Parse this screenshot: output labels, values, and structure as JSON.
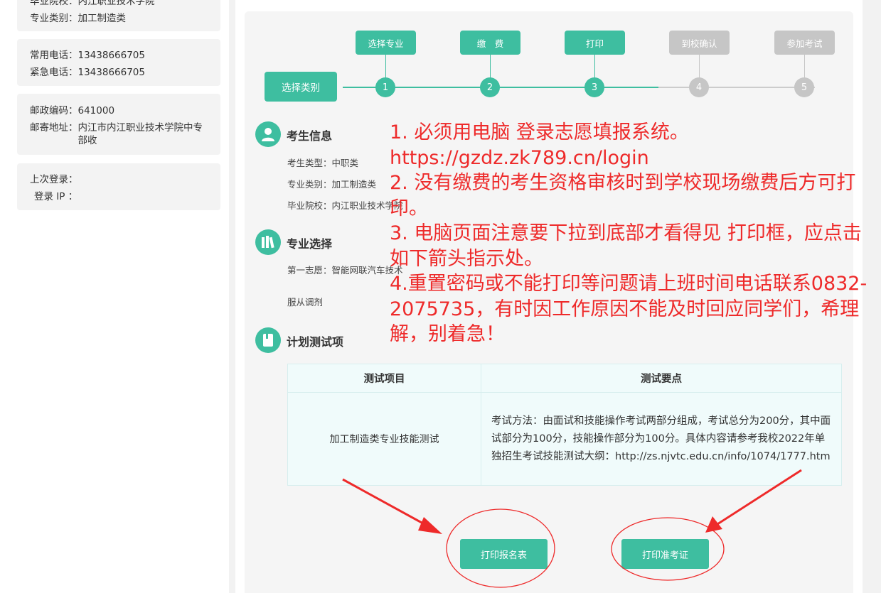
{
  "sidebar": {
    "card1": [
      {
        "label": "毕业院校：",
        "value": "内江职业技术学院"
      },
      {
        "label": "专业类别：",
        "value": "加工制造类"
      }
    ],
    "card2": [
      {
        "label": "常用电话：",
        "value": "13438666705"
      },
      {
        "label": "紧急电话：",
        "value": "13438666705"
      }
    ],
    "card3": [
      {
        "label": "邮政编码：",
        "value": "641000"
      },
      {
        "label": "邮寄地址：",
        "value": "内江市内江职业技术学院中专部收"
      }
    ],
    "card4": [
      {
        "label": "上次登录：",
        "value": ""
      },
      {
        "label": "登录 IP ：",
        "value": ""
      }
    ]
  },
  "steps": {
    "category_button": "选择类别",
    "items": [
      {
        "label": "选择专业",
        "number": "1",
        "active": true
      },
      {
        "label": "缴　费",
        "number": "2",
        "active": true
      },
      {
        "label": "打印",
        "number": "3",
        "active": true
      },
      {
        "label": "到校确认",
        "number": "4",
        "active": false
      },
      {
        "label": "参加考试",
        "number": "5",
        "active": false
      }
    ]
  },
  "student_info": {
    "title": "考生信息",
    "rows": [
      {
        "label": "考生类型：",
        "value": "中职类"
      },
      {
        "label": "专业类别：",
        "value": "加工制造类"
      },
      {
        "label": "毕业院校：",
        "value": "内江职业技术学院"
      }
    ]
  },
  "major_choice": {
    "title": "专业选择",
    "first_choice_label": "第一志愿：",
    "first_choice_value": "智能网联汽车技术",
    "obey_adjust": "服从调剂"
  },
  "test_plan": {
    "title": "计划测试项",
    "headers": [
      "测试项目",
      "测试要点"
    ],
    "item": "加工制造类专业技能测试",
    "details": "考试方法：由面试和技能操作考试两部分组成，考试总分为200分，其中面试部分为100分，技能操作部分为100分。具体内容请参考我校2022年单独招生考试技能测试大纲：http://zs.njvtc.edu.cn/info/1074/1777.htm"
  },
  "buttons": {
    "print_form": "打印报名表",
    "print_admission": "打印准考证"
  },
  "notice": [
    "1. 必须用电脑 登录志愿填报系统。",
    "https://gzdz.zk789.cn/login",
    "2. 没有缴费的考生资格审核时到学校现场缴费后方可打印。",
    "3. 电脑页面注意要下拉到底部才看得见 打印框，应点击如下箭头指示处。",
    "4.重置密码或不能打印等问题请上班时间电话联系0832-2075735，有时因工作原因不能及时回应同学们，希理解，别着急！"
  ],
  "colors": {
    "accent": "#3ebea0",
    "inactive": "#c6c6c6",
    "annotation_red": "#ee2a2a"
  }
}
